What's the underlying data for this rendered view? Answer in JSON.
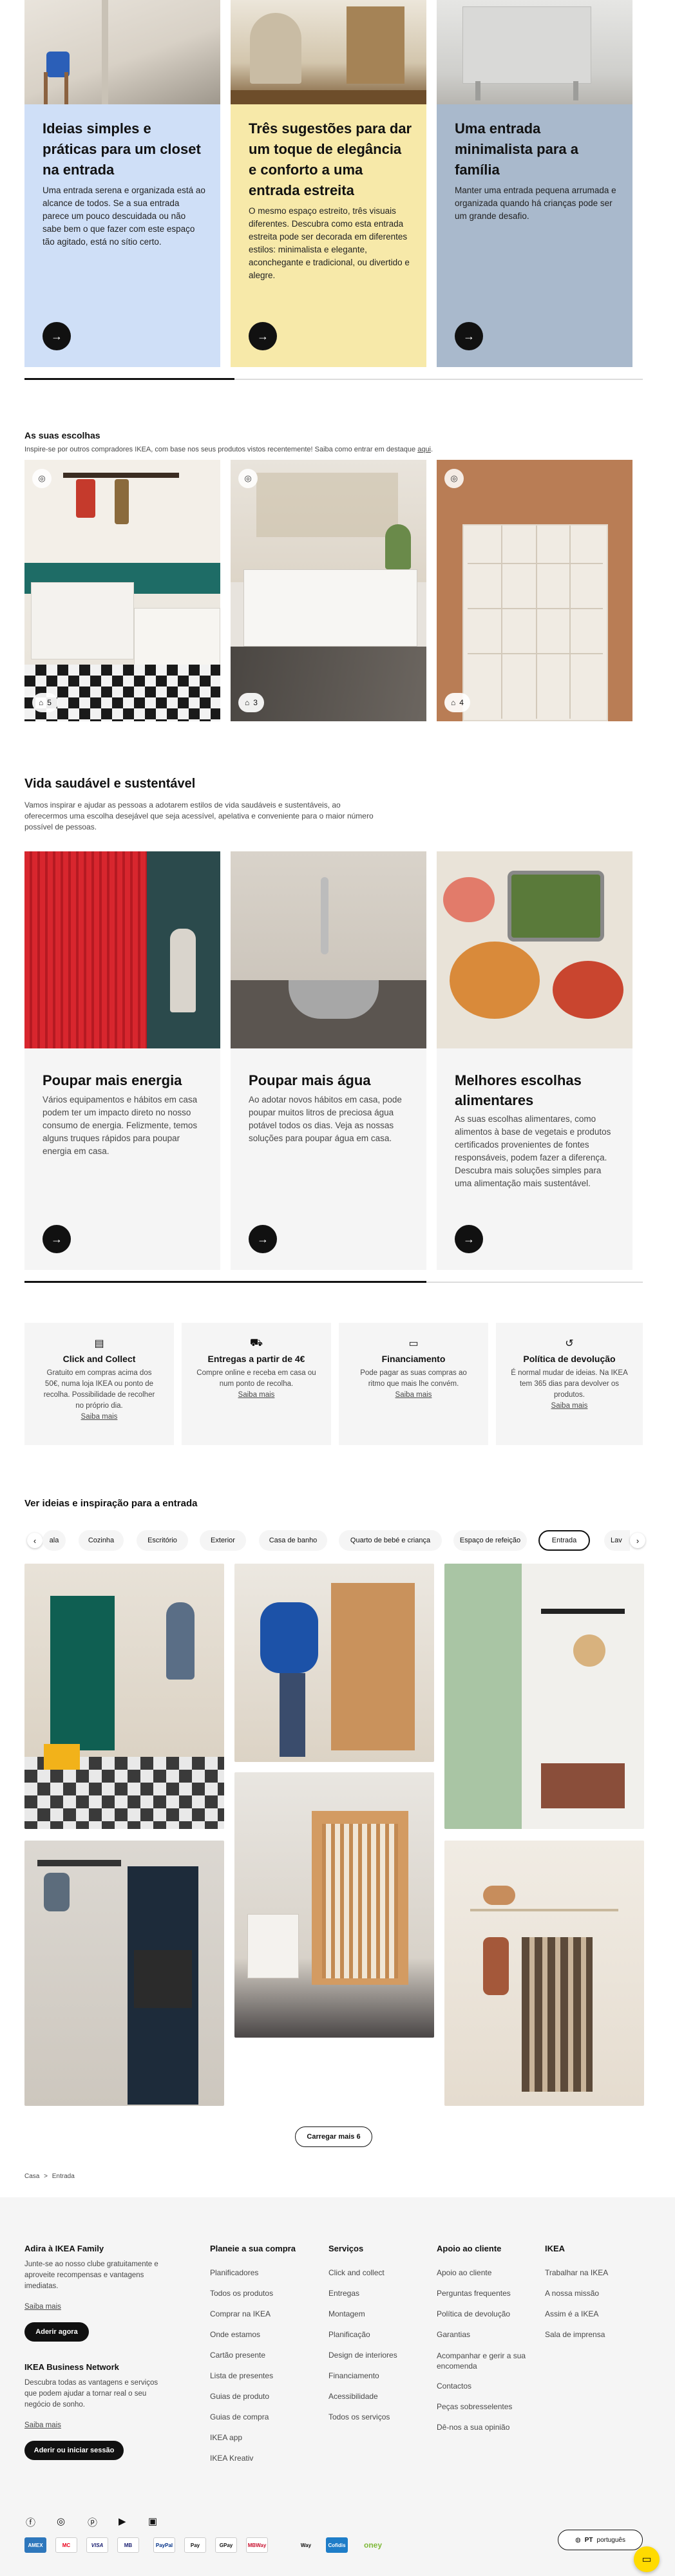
{
  "top_cards": [
    {
      "title": "Ideias simples e práticas para um closet na entrada",
      "text": "Uma entrada serena e organizada está ao alcance de todos. Se a sua entrada parece um pouco descuidada ou não sabe bem o que fazer com este espaço tão agitado, está no sítio certo.",
      "bg": "#cfdff7"
    },
    {
      "title": "Três sugestões para dar um toque de elegância e conforto a uma entrada estreita",
      "text": "O mesmo espaço estreito, três visuais diferentes. Descubra como esta entrada estreita pode ser decorada em diferentes estilos: minimalista e elegante, aconchegante e tradicional, ou divertido e alegre.",
      "bg": "#f7e9a9"
    },
    {
      "title": "Uma entrada minimalista para a família",
      "text": "Manter uma entrada pequena arrumada e organizada quando há crianças pode ser um grande desafio.",
      "bg": "#a9b9cc"
    }
  ],
  "top_progress": 0.34,
  "picks": {
    "title": "As suas escolhas",
    "subtitle_pre": "Inspire-se por outros compradores IKEA, com base nos seus produtos vistos recentemente! Saiba como entrar em destaque ",
    "subtitle_link": "aqui",
    "subtitle_post": ".",
    "items": [
      {
        "count": "5"
      },
      {
        "count": "3"
      },
      {
        "count": "4"
      }
    ]
  },
  "sustain": {
    "title": "Vida saudável e sustentável",
    "subtitle": "Vamos inspirar e ajudar as pessoas a adotarem estilos de vida saudáveis e sustentáveis, ao oferecermos uma escolha desejável que seja acessível, apelativa e conveniente para o maior número possível de pessoas.",
    "cards": [
      {
        "title": "Poupar mais energia",
        "text": "Vários equipamentos e hábitos em casa podem ter um impacto direto no nosso consumo de energia. Felizmente, temos alguns truques rápidos para poupar energia em casa."
      },
      {
        "title": "Poupar mais água",
        "text": "Ao adotar novos hábitos em casa, pode poupar muitos litros de preciosa água potável todos os dias. Veja as nossas soluções para poupar água em casa."
      },
      {
        "title": "Melhores escolhas alimentares",
        "text": "As suas escolhas alimentares, como alimentos à base de vegetais e produtos certificados provenientes de fontes responsáveis, podem fazer a diferença. Descubra mais soluções simples para uma alimentação mais sustentável."
      }
    ],
    "progress": 0.65
  },
  "services": [
    {
      "icon": "store-icon",
      "title": "Click and Collect",
      "text": "Gratuito em compras acima dos 50€, numa loja IKEA ou ponto de recolha. Possibilidade de recolher no próprio dia.",
      "link": "Saiba mais"
    },
    {
      "icon": "truck-icon",
      "title": "Entregas a partir de 4€",
      "text": "Compre online e receba em casa ou num ponto de recolha.",
      "link": "Saiba mais"
    },
    {
      "icon": "card-icon",
      "title": "Financiamento",
      "text": "Pode pagar as suas compras ao ritmo que mais lhe convém.",
      "link": "Saiba mais"
    },
    {
      "icon": "return-icon",
      "title": "Política de devolução",
      "text": "É normal mudar de ideias. Na IKEA tem 365 dias para devolver os produtos.",
      "link": "Saiba mais"
    }
  ],
  "ideas": {
    "title": "Ver ideias e inspiração para a entrada",
    "pills": [
      "ala",
      "Cozinha",
      "Escritório",
      "Exterior",
      "Casa de banho",
      "Quarto de bebé e criança",
      "Espaço de refeição",
      "Entrada",
      "Lav"
    ],
    "active_pill": "Entrada",
    "load_more": "Carregar mais 6"
  },
  "breadcrumb": {
    "home": "Casa",
    "sep": ">",
    "current": "Entrada"
  },
  "footer": {
    "family": {
      "title": "Adira à IKEA Family",
      "text": "Junte-se ao nosso clube gratuitamente e aproveite recompensas e vantagens imediatas.",
      "link": "Saiba mais",
      "button": "Aderir agora"
    },
    "business": {
      "title": "IKEA Business Network",
      "text": "Descubra todas as vantagens e serviços que podem ajudar a tornar real o seu negócio de sonho.",
      "link": "Saiba mais",
      "button": "Aderir ou iniciar sessão"
    },
    "columns": [
      {
        "title": "Planeie a sua compra",
        "links": [
          "Planificadores",
          "Todos os produtos",
          "Comprar na IKEA",
          "Onde estamos",
          "Cartão presente",
          "Lista de presentes",
          "Guias de produto",
          "Guias de compra",
          "IKEA app",
          "IKEA Kreativ"
        ]
      },
      {
        "title": "Serviços",
        "links": [
          "Click and collect",
          "Entregas",
          "Montagem",
          "Planificação",
          "Design de interiores",
          "Financiamento",
          "Acessibilidade",
          "Todos os serviços"
        ]
      },
      {
        "title": "Apoio ao cliente",
        "links": [
          "Apoio ao cliente",
          "Perguntas frequentes",
          "Política de devolução",
          "Garantias",
          "Acompanhar e gerir a sua encomenda",
          "Contactos",
          "Peças sobresselentes",
          "Dê-nos a sua opinião"
        ]
      },
      {
        "title": "IKEA",
        "links": [
          "Trabalhar na IKEA",
          "A nossa missão",
          "Assim é a IKEA",
          "Sala de imprensa"
        ]
      }
    ],
    "social": [
      "facebook-icon",
      "instagram-icon",
      "pinterest-icon",
      "youtube-icon",
      "linkedin-icon"
    ],
    "payments": [
      "AMEX",
      "MC",
      "VISA",
      "MB",
      "PayPal",
      "Pay",
      "GPay",
      "MBWay",
      "Way",
      "Cofidis",
      "oney"
    ],
    "lang": {
      "code": "PT",
      "label": "português"
    }
  },
  "colors": {
    "accent": "#0058a3",
    "chat": "#ffdb00"
  }
}
